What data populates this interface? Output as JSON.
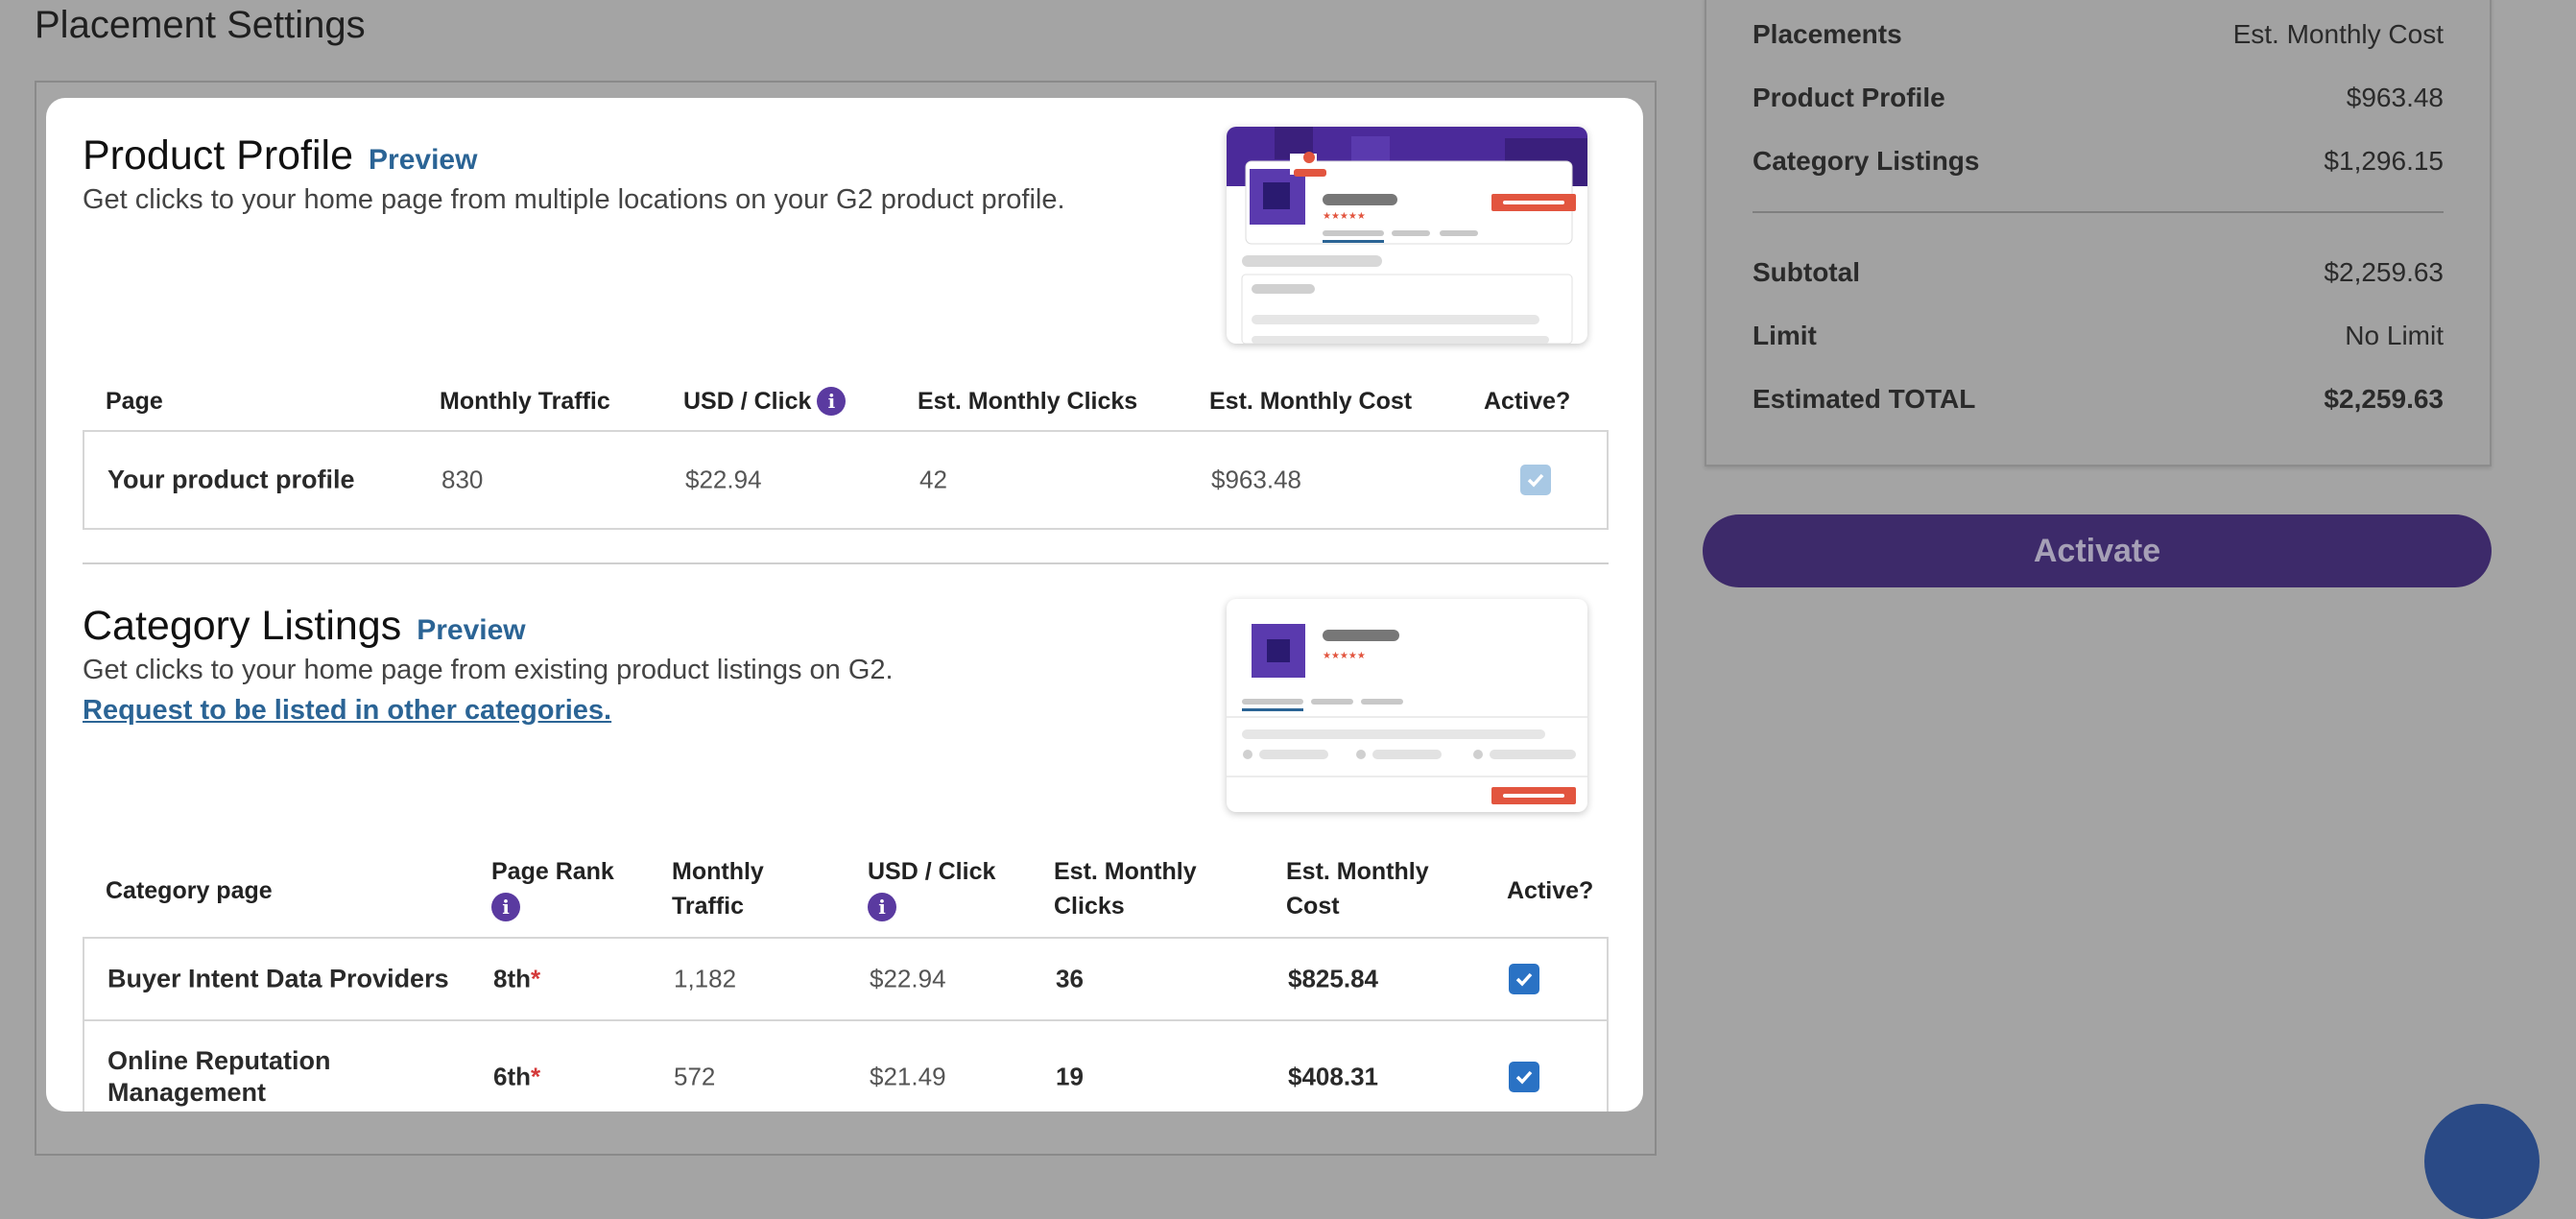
{
  "page": {
    "title": "Placement Settings"
  },
  "summary": {
    "header": {
      "label": "Placements",
      "value": "Est. Monthly Cost"
    },
    "items": [
      {
        "label": "Product Profile",
        "value": "$963.48"
      },
      {
        "label": "Category Listings",
        "value": "$1,296.15"
      }
    ],
    "subtotal": {
      "label": "Subtotal",
      "value": "$2,259.63"
    },
    "limit": {
      "label": "Limit",
      "value": "No Limit"
    },
    "total": {
      "label": "Estimated TOTAL",
      "value": "$2,259.63"
    },
    "activate_label": "Activate"
  },
  "product_profile": {
    "title": "Product Profile",
    "preview_label": "Preview",
    "description": "Get clicks to your home page from multiple locations on your G2 product profile.",
    "columns": [
      "Page",
      "Monthly Traffic",
      "USD / Click",
      "Est. Monthly Clicks",
      "Est. Monthly Cost",
      "Active?"
    ],
    "rows": [
      {
        "page": "Your product profile",
        "traffic": "830",
        "usd_click": "$22.94",
        "clicks": "42",
        "cost": "$963.48",
        "active": true
      }
    ]
  },
  "category_listings": {
    "title": "Category Listings",
    "preview_label": "Preview",
    "description": "Get clicks to your home page from existing product listings on G2.",
    "request_link": "Request to be listed in other categories.",
    "columns": {
      "category": "Category page",
      "rank": "Page Rank",
      "traffic_1": "Monthly",
      "traffic_2": "Traffic",
      "usd_click": "USD / Click",
      "clicks_1": "Est. Monthly",
      "clicks_2": "Clicks",
      "cost_1": "Est. Monthly",
      "cost_2": "Cost",
      "active": "Active?"
    },
    "rows": [
      {
        "category_1": "Buyer Intent Data Providers",
        "category_2": "",
        "rank": "8th",
        "traffic": "1,182",
        "usd_click": "$22.94",
        "clicks": "36",
        "cost": "$825.84",
        "active": true
      },
      {
        "category_1": "Online Reputation",
        "category_2": "Management",
        "rank": "6th",
        "traffic": "572",
        "usd_click": "$21.49",
        "clicks": "19",
        "cost": "$408.31",
        "active": true
      }
    ],
    "rank_asterisk": "*"
  },
  "icons": {
    "info": "info-icon",
    "check": "check-icon"
  },
  "colors": {
    "brand_purple": "#3d2a6a",
    "link_blue": "#2b6495",
    "check_blue": "#2a72c4",
    "accent_red": "#e2553f"
  }
}
